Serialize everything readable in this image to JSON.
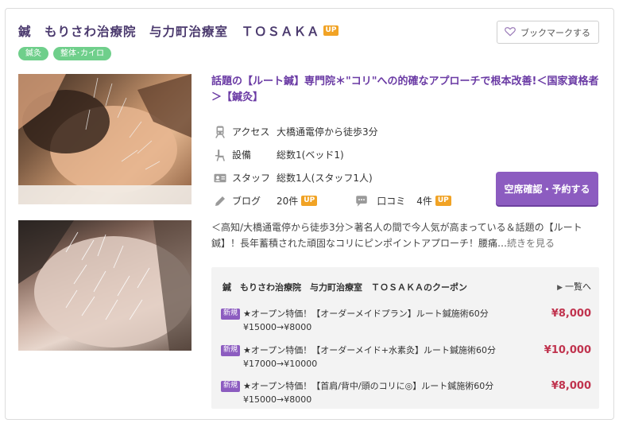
{
  "salon": {
    "title": "鍼　もりさわ治療院　与力町治療室　ＴＯＳＡＫＡ",
    "up_badge": "UP",
    "bookmark_label": "ブックマークする",
    "tags": [
      "鍼灸",
      "整体･カイロ"
    ],
    "headline": "話題の【ルート鍼】専門院＊\"コリ\"への的確なアプローチで根本改善!＜国家資格者＞【鍼灸】",
    "info": {
      "access_label": "アクセス",
      "access_value": "大橋通電停から徒歩3分",
      "equipment_label": "設備",
      "equipment_value": "総数1(ベッド1)",
      "staff_label": "スタッフ",
      "staff_value": "総数1人(スタッフ1人)",
      "blog_label": "ブログ",
      "blog_count": "20件",
      "review_label": "口コミ",
      "review_count": "4件"
    },
    "reserve_label": "空席確認・予約する",
    "description": "＜高知/大橋通電停から徒歩3分＞著名人の間で今人気が高まっている＆話題の【ルート鍼】！長年蓄積された頑固なコリにピンポイントアプローチ！腰痛…",
    "more_label": "続きを見る"
  },
  "coupons": {
    "header": "鍼　もりさわ治療院　与力町治療室　ＴＯＳＡＫＡのクーポン",
    "all_label": "一覧へ",
    "new_badge": "新規",
    "items": [
      {
        "text": "★オープン特価！【オーダーメイドプラン】ルート鍼施術60分¥15000→¥8000",
        "price": "¥8,000"
      },
      {
        "text": "★オープン特価！【オーダーメイド+水素灸】ルート鍼施術60分¥17000→¥10000",
        "price": "¥10,000"
      },
      {
        "text": "★オープン特価！【首肩/背中/頭のコリに◎】ルート鍼施術60分¥15000→¥8000",
        "price": "¥8,000"
      }
    ]
  },
  "colors": {
    "title": "#4b3a6e",
    "headline": "#6a3aa4",
    "tag": "#6fcf8b",
    "accent": "#8c5cc0",
    "up": "#f1a325",
    "price": "#c0334e"
  },
  "icons": [
    "heart-icon",
    "train-icon",
    "chair-icon",
    "staff-card-icon",
    "pen-icon",
    "speech-bubble-icon",
    "arrow-right-icon"
  ]
}
